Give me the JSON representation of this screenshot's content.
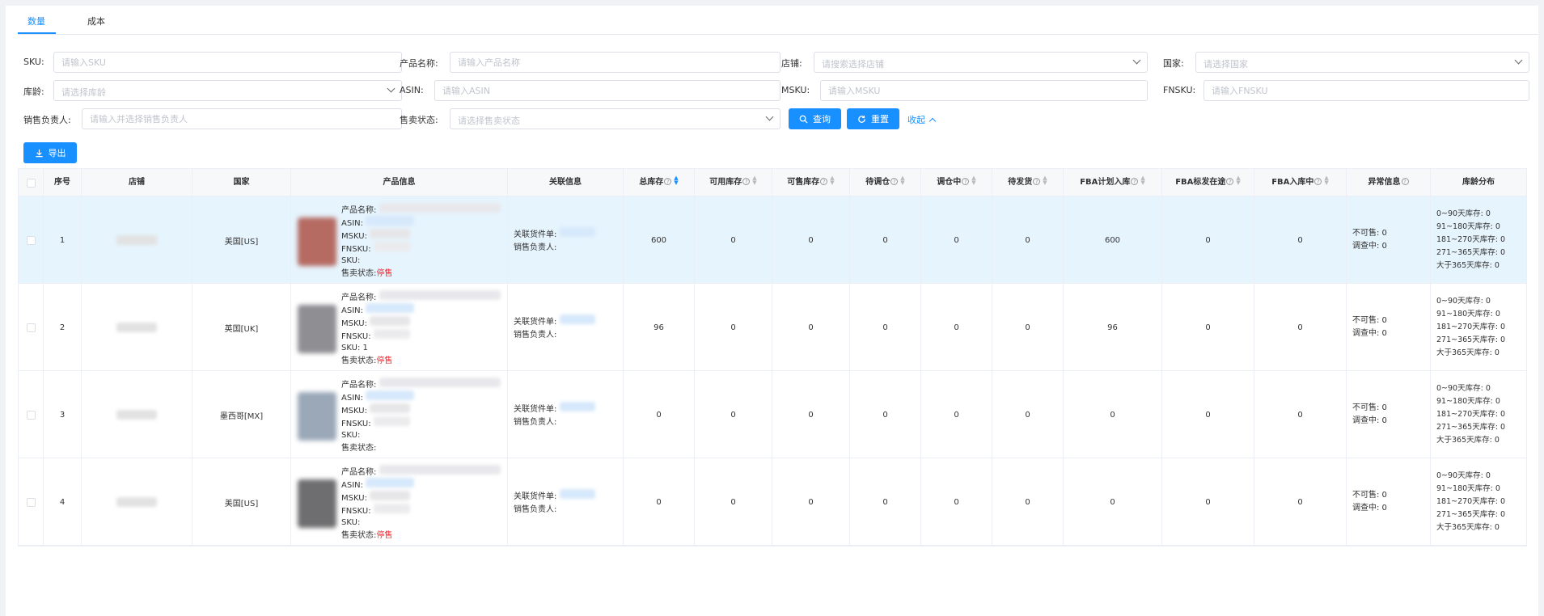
{
  "tabs": [
    {
      "label": "数量"
    },
    {
      "label": "成本"
    }
  ],
  "filters": {
    "sku": {
      "label": "SKU:",
      "placeholder": "请输入SKU"
    },
    "product_name": {
      "label": "产品名称:",
      "placeholder": "请输入产品名称"
    },
    "store": {
      "label": "店铺:",
      "placeholder": "请搜索选择店铺"
    },
    "country": {
      "label": "国家:",
      "placeholder": "请选择国家"
    },
    "stock_age": {
      "label": "库龄:",
      "placeholder": "请选择库龄"
    },
    "asin": {
      "label": "ASIN:",
      "placeholder": "请输入ASIN"
    },
    "msku": {
      "label": "MSKU:",
      "placeholder": "请输入MSKU"
    },
    "fnsku": {
      "label": "FNSKU:",
      "placeholder": "请输入FNSKU"
    },
    "sales_owner": {
      "label": "销售负责人:",
      "placeholder": "请输入并选择销售负责人"
    },
    "sale_status": {
      "label": "售卖状态:",
      "placeholder": "请选择售卖状态"
    },
    "query_label": "查询",
    "reset_label": "重置",
    "collapse_label": "收起",
    "export_label": "导出"
  },
  "table": {
    "headers": {
      "index": "序号",
      "store": "店铺",
      "country": "国家",
      "product": "产品信息",
      "related": "关联信息",
      "total_stock": "总库存",
      "available": "可用库存",
      "sellable": "可售库存",
      "pending_transfer": "待调仓",
      "transferring": "调仓中",
      "pending_ship": "待发货",
      "fba_planned": "FBA计划入库",
      "fba_in_transit": "FBA标发在途",
      "fba_receiving": "FBA入库中",
      "exception": "异常信息",
      "age_dist": "库龄分布"
    },
    "product_labels": {
      "name": "产品名称:",
      "asin": "ASIN:",
      "msku": "MSKU:",
      "fnsku": "FNSKU:",
      "sku": "SKU:",
      "status": "售卖状态:",
      "status_stop": "停售"
    },
    "related_labels": {
      "order": "关联货件单:",
      "owner": "销售负责人:"
    },
    "exception_labels": {
      "unsellable": "不可售: 0",
      "investigating": "调查中: 0"
    },
    "age_labels": [
      "0~90天库存: 0",
      "91~180天库存: 0",
      "181~270天库存: 0",
      "271~365天库存: 0",
      "大于365天库存: 0"
    ],
    "rows": [
      {
        "index": "1",
        "country": "美国[US]",
        "total": "600",
        "available": "0",
        "sellable": "0",
        "pending_transfer": "0",
        "transferring": "0",
        "pending_ship": "0",
        "fba_planned": "600",
        "fba_in_transit": "0",
        "fba_receiving": "0",
        "status_text": "停售",
        "sku_text": "SKU:"
      },
      {
        "index": "2",
        "country": "英国[UK]",
        "total": "96",
        "available": "0",
        "sellable": "0",
        "pending_transfer": "0",
        "transferring": "0",
        "pending_ship": "0",
        "fba_planned": "96",
        "fba_in_transit": "0",
        "fba_receiving": "0",
        "status_text": "停售",
        "sku_text": "SKU: 1"
      },
      {
        "index": "3",
        "country": "墨西哥[MX]",
        "total": "0",
        "available": "0",
        "sellable": "0",
        "pending_transfer": "0",
        "transferring": "0",
        "pending_ship": "0",
        "fba_planned": "0",
        "fba_in_transit": "0",
        "fba_receiving": "0",
        "status_text": "",
        "sku_text": "SKU:"
      },
      {
        "index": "4",
        "country": "美国[US]",
        "total": "0",
        "available": "0",
        "sellable": "0",
        "pending_transfer": "0",
        "transferring": "0",
        "pending_ship": "0",
        "fba_planned": "0",
        "fba_in_transit": "0",
        "fba_receiving": "0",
        "status_text": "停售",
        "sku_text": "SKU:"
      }
    ]
  },
  "colors": {
    "primary": "#1890ff",
    "danger": "#f5222d",
    "row_highlight": "#e6f4fd"
  }
}
